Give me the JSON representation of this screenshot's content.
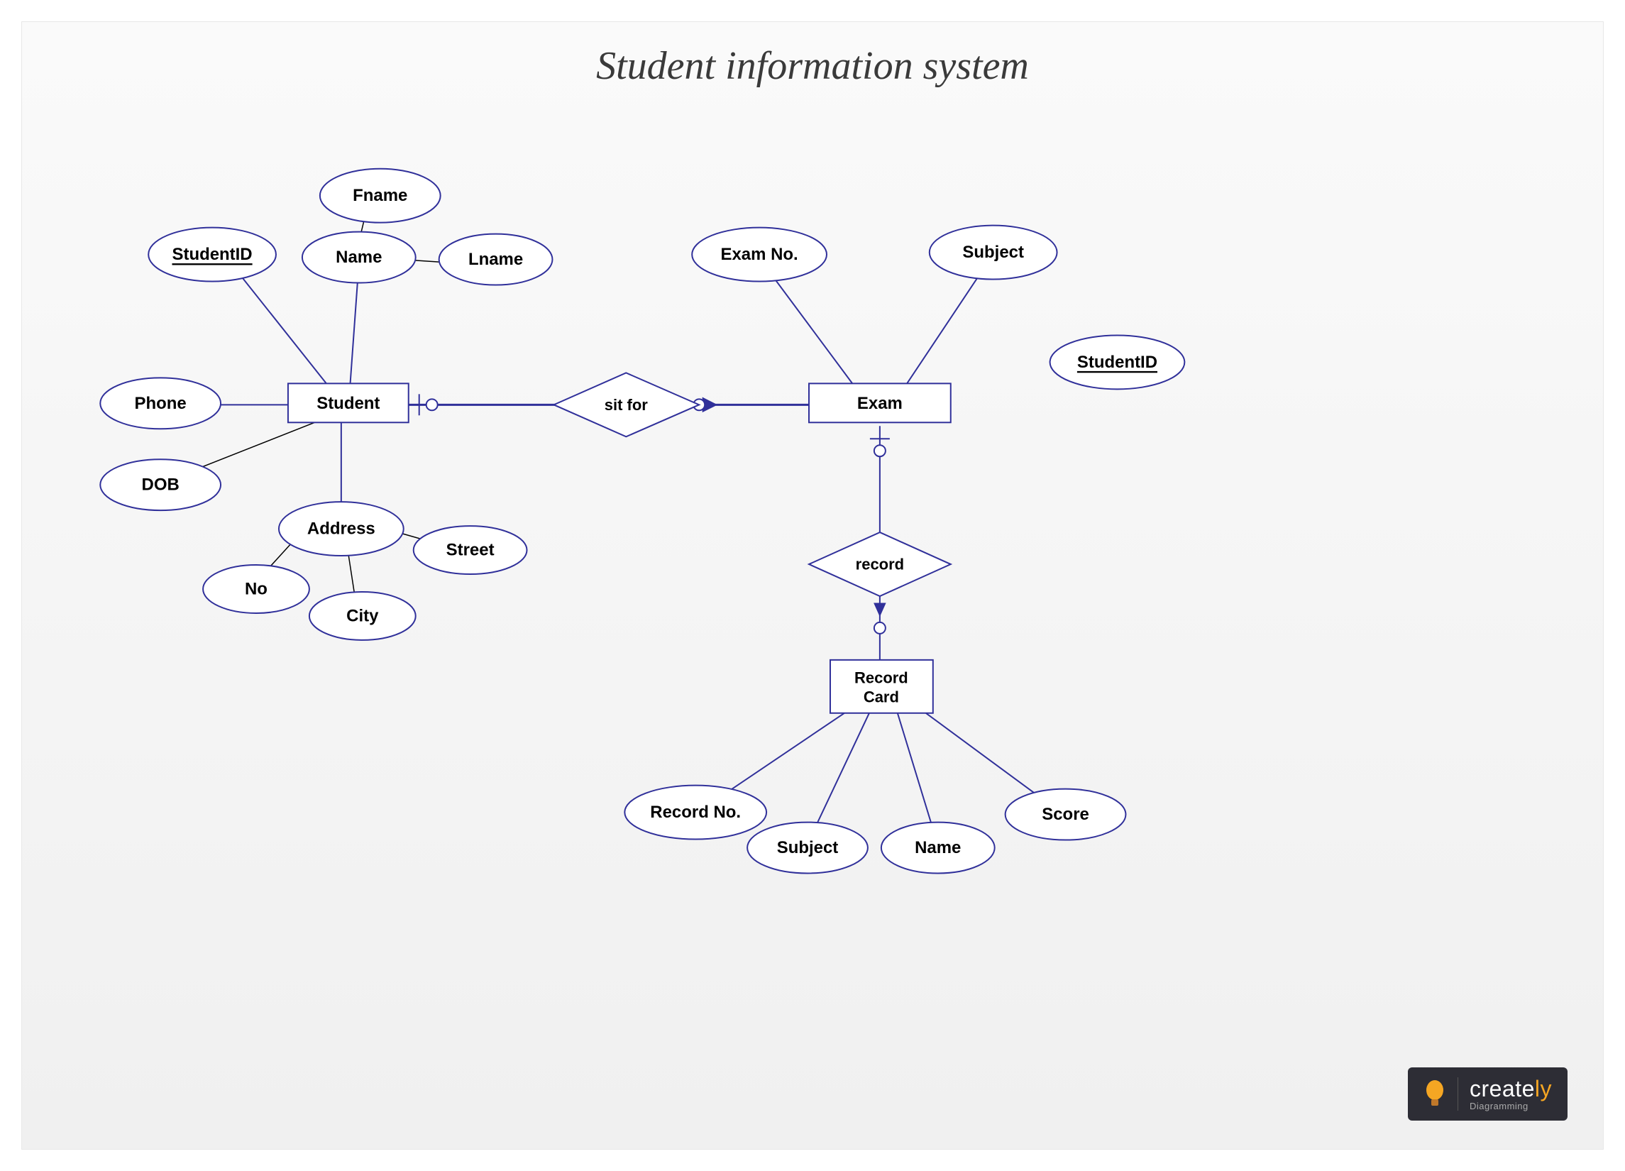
{
  "title": "Student information system",
  "entities": {
    "student": "Student",
    "exam": "Exam",
    "record_card_l1": "Record",
    "record_card_l2": "Card"
  },
  "relationships": {
    "sit_for": "sit for",
    "record": "record"
  },
  "attributes": {
    "student_id": "StudentID",
    "phone": "Phone",
    "dob": "DOB",
    "name": "Name",
    "fname": "Fname",
    "lname": "Lname",
    "address": "Address",
    "no": "No",
    "city": "City",
    "street": "Street",
    "exam_no": "Exam No.",
    "subject_exam": "Subject",
    "student_id_exam": "StudentID",
    "record_no": "Record No.",
    "subject_rec": "Subject",
    "name_rec": "Name",
    "score": "Score"
  },
  "logo": {
    "brand_part1": "create",
    "brand_part2": "ly",
    "subtitle": "Diagramming"
  },
  "colors": {
    "shape_stroke": "#30309a",
    "background_start": "#fafafa",
    "background_end": "#f0f0f0",
    "logo_bg": "#2d2d35",
    "logo_accent": "#f5a623"
  }
}
